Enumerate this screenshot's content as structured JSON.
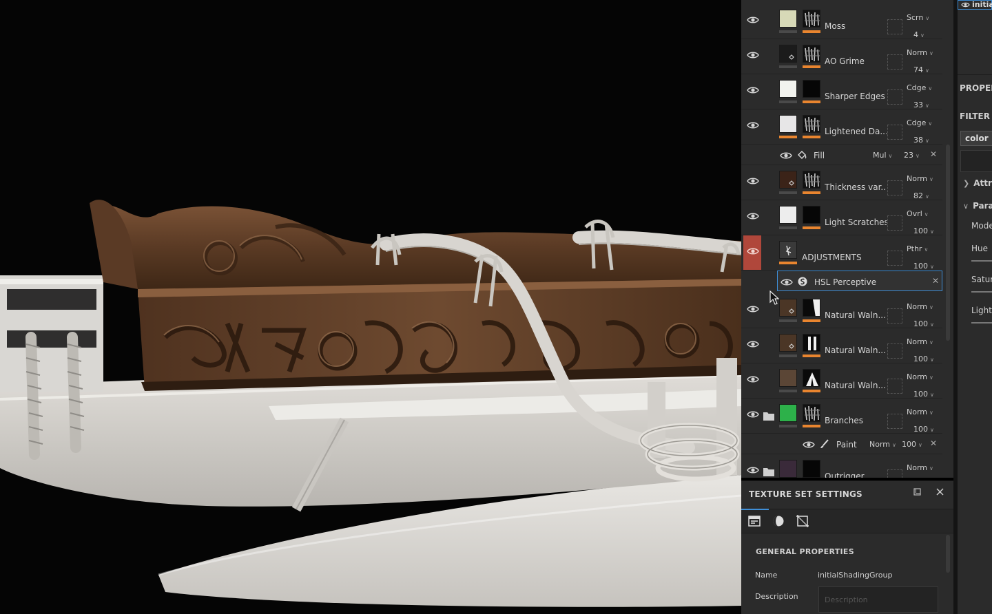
{
  "layers": [
    {
      "name": "Moss",
      "blend": "Scrn",
      "opacity": "4",
      "color": "#d7d9b7",
      "mask": "noise",
      "folder": false,
      "eye": true
    },
    {
      "name": "AO Grime",
      "blend": "Norm",
      "opacity": "74",
      "color": "#1b1b1b",
      "mask": "noise",
      "folder": false,
      "eye": true,
      "fill_icon": true
    },
    {
      "name": "Sharper Edges",
      "blend": "Cdge",
      "opacity": "33",
      "color": "#f2f3ee",
      "mask": "dark",
      "folder": false,
      "eye": true
    },
    {
      "name": "Lightened Da...",
      "blend": "Cdge",
      "opacity": "38",
      "color": "#e7e6e7",
      "mask": "noise",
      "folder": false,
      "eye": true,
      "orange_left": true
    },
    {
      "name": "Thickness var...",
      "blend": "Norm",
      "opacity": "82",
      "color": "#3b2318",
      "mask": "noise",
      "folder": false,
      "eye": true,
      "fill_icon": true
    },
    {
      "name": "Light Scratches",
      "blend": "Ovrl",
      "opacity": "100",
      "color": "#ededed",
      "mask": "dark",
      "folder": false,
      "eye": true
    },
    {
      "name": "ADJUSTMENTS",
      "blend": "Pthr",
      "opacity": "100",
      "color": "#3a3a3a",
      "mask": "none",
      "folder": false,
      "eye": true,
      "selected": true,
      "orange_left": true
    },
    {
      "name": "Natural Waln...",
      "blend": "Norm",
      "opacity": "100",
      "color": "#4b3626",
      "mask": "split",
      "folder": false,
      "eye": true,
      "fill_icon": true
    },
    {
      "name": "Natural Waln...",
      "blend": "Norm",
      "opacity": "100",
      "color": "#4b3626",
      "mask": "bars",
      "folder": false,
      "eye": true,
      "fill_icon": true
    },
    {
      "name": "Natural Waln...",
      "blend": "Norm",
      "opacity": "100",
      "color": "#5b4636",
      "mask": "peak",
      "folder": false,
      "eye": true
    },
    {
      "name": "Branches",
      "blend": "Norm",
      "opacity": "100",
      "color": "#2db14a",
      "mask": "noise",
      "folder": true,
      "eye": true
    },
    {
      "name": "Outrigger",
      "blend": "Norm",
      "opacity": "",
      "color": "#3a2a3a",
      "mask": "dark",
      "folder": true,
      "eye": true
    }
  ],
  "sublayers": [
    {
      "name": "Fill",
      "blend": "Mul",
      "opacity": "23",
      "icon": "fill-bucket-icon",
      "after": 3
    },
    {
      "name": "HSL Perceptive",
      "blend": "",
      "opacity": "",
      "icon": "hsl-filter-icon",
      "after": 6,
      "selected": true
    },
    {
      "name": "Paint",
      "blend": "Norm",
      "opacity": "100",
      "icon": "brush-icon",
      "after": 10
    }
  ],
  "texture_set_settings": {
    "title": "TEXTURE SET SETTINGS",
    "section": "GENERAL PROPERTIES",
    "name_label": "Name",
    "name_value": "initialShadingGroup",
    "description_label": "Description",
    "description_placeholder": "Description"
  },
  "properties_panel": {
    "top_label": "initia",
    "header": "PROPER",
    "filter_header": "FILTER",
    "filter_button": "color",
    "group_attributes": "Attri",
    "group_parameters": "Para",
    "param_mode": "Mode",
    "param_hue": "Hue",
    "param_saturation": "Satur",
    "param_lightness": "Lightr"
  },
  "colors": {
    "accent_blue": "#3f8fd8",
    "mask_orange": "#e9852f",
    "selection_red": "#b0473b",
    "panel_bg": "#2b2b2b"
  }
}
